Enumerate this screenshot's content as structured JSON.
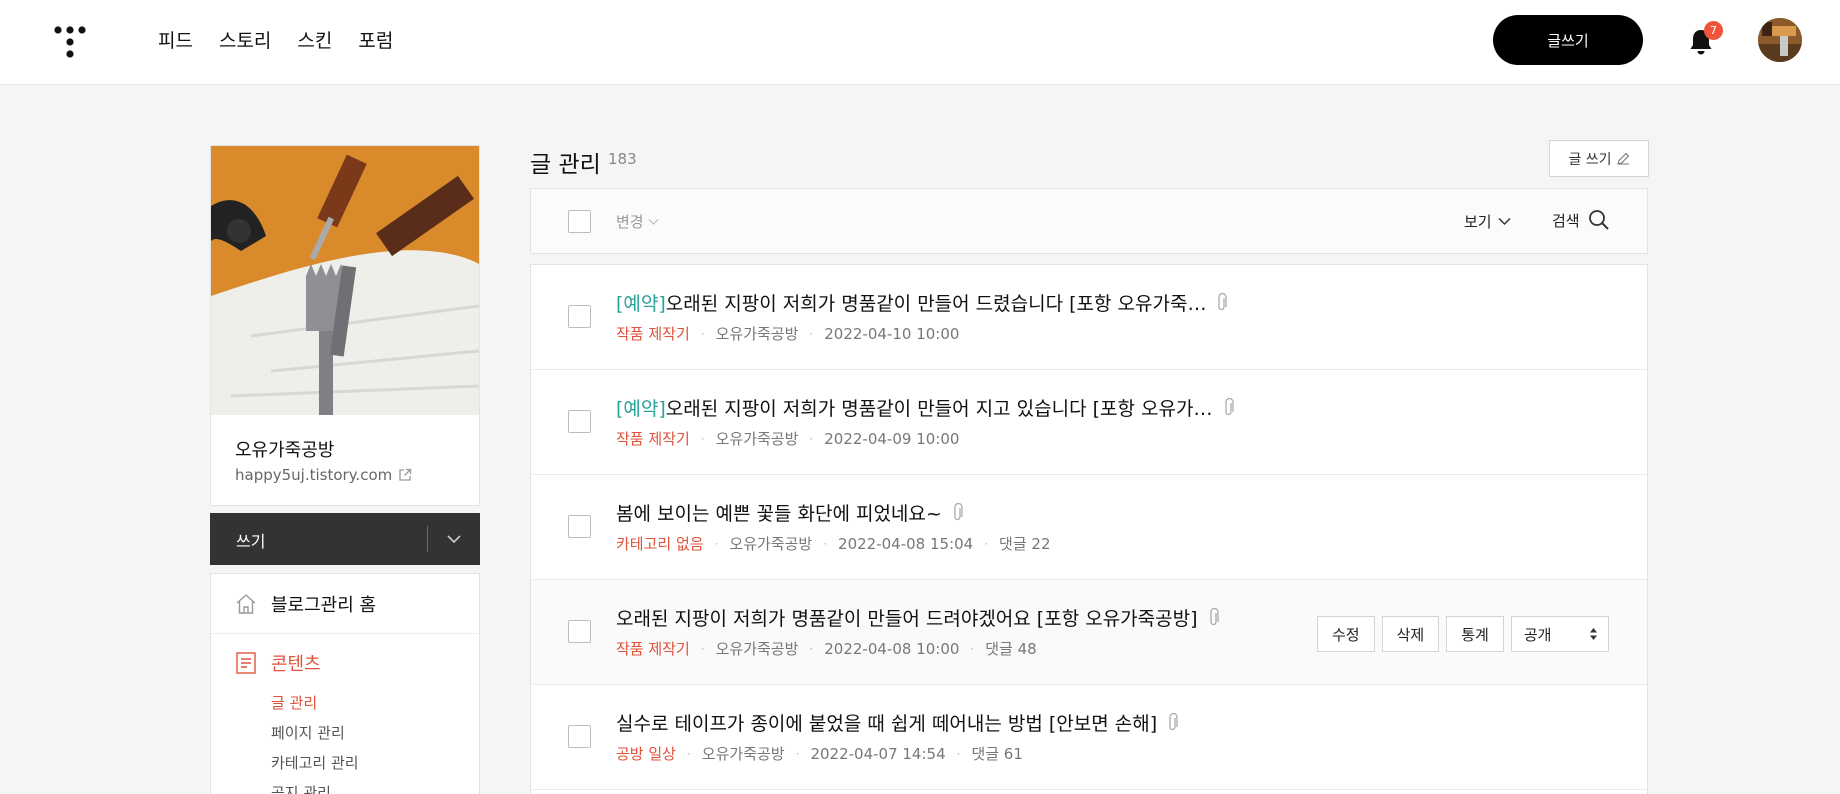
{
  "header": {
    "nav": [
      "피드",
      "스토리",
      "스킨",
      "포럼"
    ],
    "write_label": "글쓰기",
    "notification_count": "7"
  },
  "sidebar": {
    "blog_name": "오유가죽공방",
    "blog_url": "happy5uj.tistory.com",
    "write_bar_label": "쓰기",
    "home_label": "블로그관리 홈",
    "contents_label": "콘텐츠",
    "submenu": [
      "글 관리",
      "페이지 관리",
      "카테고리 관리",
      "공지 관리"
    ]
  },
  "main": {
    "title": "글 관리",
    "count": "183",
    "new_post_label": "글 쓰기",
    "toolbar": {
      "change_label": "변경",
      "view_label": "보기",
      "search_label": "검색"
    },
    "posts": [
      {
        "prefix": "[예약]",
        "title": "오래된 지팡이 저희가 명품같이 만들어 드렸습니다 [포항 오유가죽…",
        "category": "작품 제작기",
        "author": "오유가죽공방",
        "date": "2022-04-10 10:00",
        "comments": ""
      },
      {
        "prefix": "[예약]",
        "title": "오래된 지팡이 저희가 명품같이 만들어 지고 있습니다 [포항 오유가…",
        "category": "작품 제작기",
        "author": "오유가죽공방",
        "date": "2022-04-09 10:00",
        "comments": ""
      },
      {
        "prefix": "",
        "title": "봄에 보이는 예쁜 꽃들 화단에 피었네요~",
        "category": "카테고리 없음",
        "author": "오유가죽공방",
        "date": "2022-04-08 15:04",
        "comments": "댓글 22"
      },
      {
        "prefix": "",
        "title": "오래된 지팡이 저희가 명품같이 만들어 드려야겠어요 [포항 오유가죽공방]",
        "category": "작품 제작기",
        "author": "오유가죽공방",
        "date": "2022-04-08 10:00",
        "comments": "댓글 48"
      },
      {
        "prefix": "",
        "title": "실수로 테이프가 종이에 붙었을 때 쉽게 떼어내는 방법 [안보면 손해]",
        "category": "공방 일상",
        "author": "오유가죽공방",
        "date": "2022-04-07 14:54",
        "comments": "댓글 61"
      }
    ],
    "row_actions": {
      "edit": "수정",
      "delete": "삭제",
      "stats": "통계",
      "visibility": "공개"
    }
  },
  "colors": {
    "accent": "#e0523a",
    "reserved": "#2aa39b",
    "badge": "#f0533b"
  }
}
